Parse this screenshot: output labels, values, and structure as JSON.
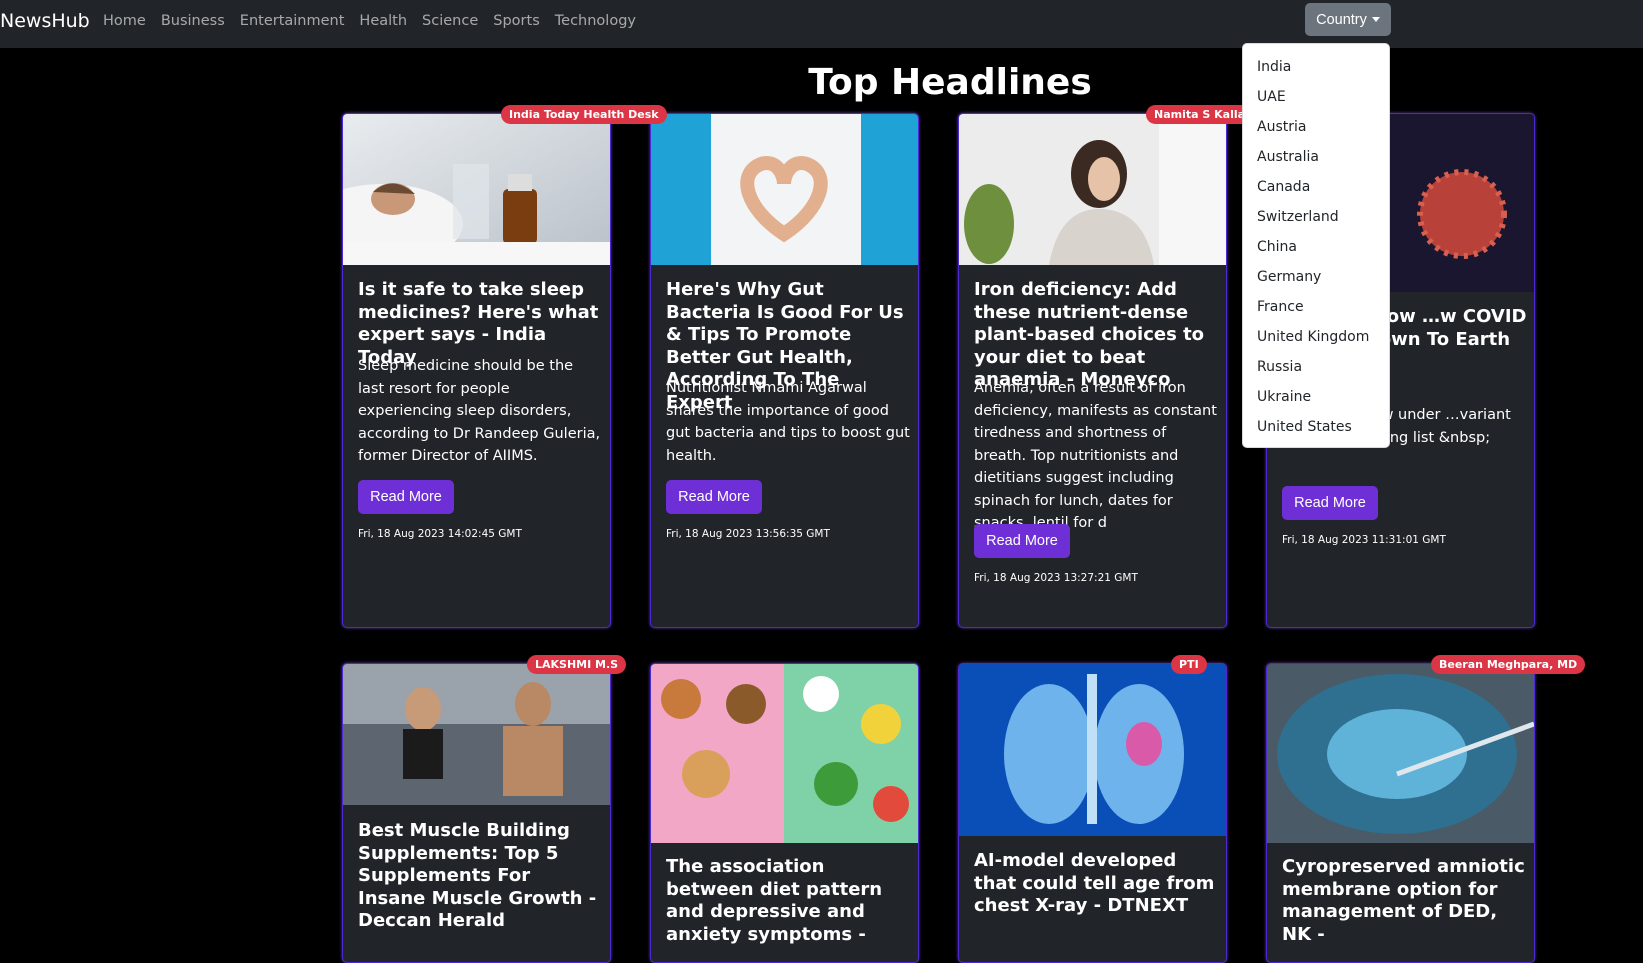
{
  "nav": {
    "brand": "NewsHub",
    "links": [
      "Home",
      "Business",
      "Entertainment",
      "Health",
      "Science",
      "Sports",
      "Technology"
    ],
    "country_label": "Country"
  },
  "dropdown": {
    "items": [
      "India",
      "UAE",
      "Austria",
      "Australia",
      "Canada",
      "Switzerland",
      "China",
      "Germany",
      "France",
      "United Kingdom",
      "Russia",
      "Ukraine",
      "United States"
    ]
  },
  "heading": "Top Headlines",
  "read_more": "Read More",
  "cards": [
    {
      "badge": "India Today Health Desk",
      "title": "Is it safe to take sleep medicines? Here's what expert says - India Today",
      "desc": "Sleep medicine should be the last resort for people experiencing sleep disorders, according to Dr Randeep Guleria, former Director of AIIMS.",
      "date": "Fri, 18 Aug 2023 14:02:45 GMT"
    },
    {
      "badge": "",
      "title": "Here's Why Gut Bacteria Is Good For Us & Tips To Promote Better Gut Health, According To The Expert",
      "desc": "Nutritionist Nmami Agarwal shares the importance of good gut bacteria and tips to boost gut health.",
      "date": "Fri, 18 Aug 2023 13:56:35 GMT"
    },
    {
      "badge": "Namita S Kalla",
      "title": "Iron deficiency: Add these nutrient-dense plant-based choices to your diet to beat anaemia - Moneyco",
      "desc": "Anemia, often a result of iron deficiency, manifests as constant tiredness and shortness of breath. Top nutritionists and dietitians suggest including spinach for lunch, dates for snacks, lentil for d",
      "date": "Fri, 18 Aug 2023 13:27:21 GMT"
    },
    {
      "badge": "",
      "title": "…DC are now …w COVID variant …own To Earth",
      "desc": "…, lineage now under …variant under monitoring list &nbsp;",
      "date": "Fri, 18 Aug 2023 11:31:01 GMT"
    },
    {
      "badge": "LAKSHMI M.S",
      "title": "Best Muscle Building Supplements: Top 5 Supplements For Insane Muscle Growth - Deccan Herald"
    },
    {
      "badge": "",
      "title": "The association between diet pattern and depressive and anxiety symptoms -"
    },
    {
      "badge": "PTI",
      "title": "AI-model developed that could tell age from chest X-ray - DTNEXT"
    },
    {
      "badge": "Beeran Meghpara, MD",
      "title": "Cyropreserved amniotic membrane option for management of DED, NK -"
    }
  ]
}
